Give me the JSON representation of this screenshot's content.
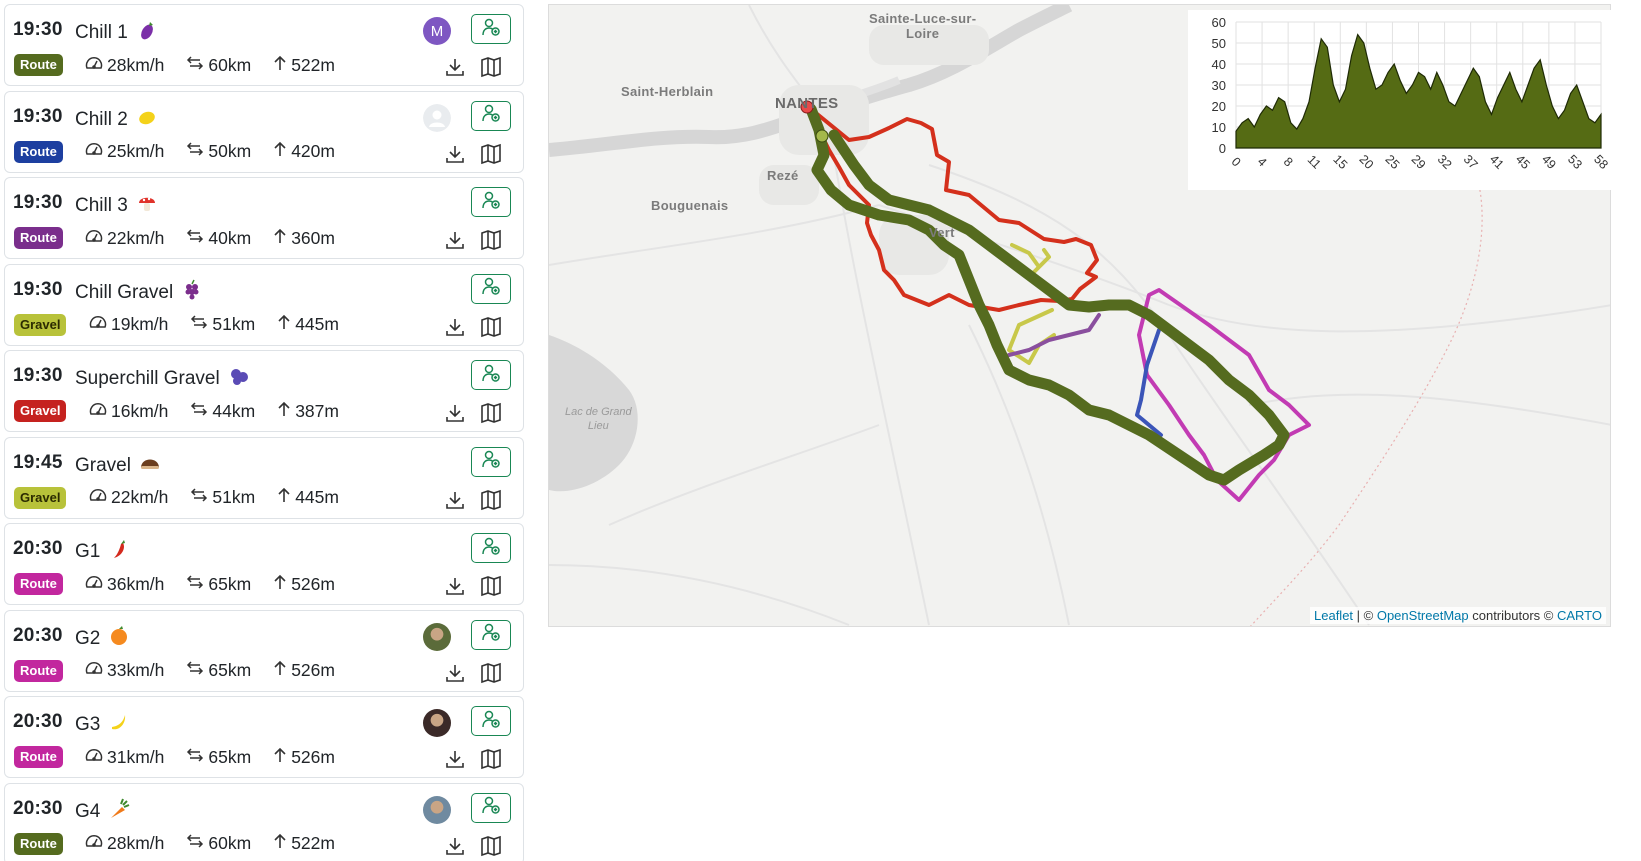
{
  "rides": [
    {
      "time": "19:30",
      "name": "Chill 1",
      "emoji": "eggplant",
      "avatar": {
        "type": "letter",
        "letter": "M",
        "color": "#7e57c2"
      },
      "badge": "Route",
      "badge_color": "#556b1f",
      "speed": "28km/h",
      "distance": "60km",
      "elevation": "522m"
    },
    {
      "time": "19:30",
      "name": "Chill 2",
      "emoji": "lemon",
      "avatar": {
        "type": "placeholder"
      },
      "badge": "Route",
      "badge_color": "#1d3fa0",
      "speed": "25km/h",
      "distance": "50km",
      "elevation": "420m"
    },
    {
      "time": "19:30",
      "name": "Chill 3",
      "emoji": "mushroom",
      "avatar": {
        "type": "none"
      },
      "badge": "Route",
      "badge_color": "#7a2e8c",
      "speed": "22km/h",
      "distance": "40km",
      "elevation": "360m"
    },
    {
      "time": "19:30",
      "name": "Chill Gravel",
      "emoji": "grapes",
      "avatar": {
        "type": "none"
      },
      "badge": "Gravel",
      "badge_color": "#b8c23a",
      "badge_text_color": "#2b2b00",
      "speed": "19km/h",
      "distance": "51km",
      "elevation": "445m"
    },
    {
      "time": "19:30",
      "name": "Superchill Gravel",
      "emoji": "blueberries",
      "avatar": {
        "type": "none"
      },
      "badge": "Gravel",
      "badge_color": "#c5221f",
      "speed": "16km/h",
      "distance": "44km",
      "elevation": "387m"
    },
    {
      "time": "19:45",
      "name": "Gravel",
      "emoji": "chestnut",
      "avatar": {
        "type": "none"
      },
      "badge": "Gravel",
      "badge_color": "#b8c23a",
      "badge_text_color": "#2b2b00",
      "speed": "22km/h",
      "distance": "51km",
      "elevation": "445m"
    },
    {
      "time": "20:30",
      "name": "G1",
      "emoji": "hot-pepper",
      "avatar": {
        "type": "none"
      },
      "badge": "Route",
      "badge_color": "#c2279e",
      "speed": "36km/h",
      "distance": "65km",
      "elevation": "526m"
    },
    {
      "time": "20:30",
      "name": "G2",
      "emoji": "tangerine",
      "avatar": {
        "type": "photo",
        "color": "#5b6b3a"
      },
      "badge": "Route",
      "badge_color": "#c2279e",
      "speed": "33km/h",
      "distance": "65km",
      "elevation": "526m"
    },
    {
      "time": "20:30",
      "name": "G3",
      "emoji": "banana",
      "avatar": {
        "type": "photo",
        "color": "#3b2a28"
      },
      "badge": "Route",
      "badge_color": "#c2279e",
      "speed": "31km/h",
      "distance": "65km",
      "elevation": "526m"
    },
    {
      "time": "20:30",
      "name": "G4",
      "emoji": "carrot",
      "avatar": {
        "type": "photo",
        "color": "#6f8aa0"
      },
      "badge": "Route",
      "badge_color": "#556b1f",
      "speed": "28km/h",
      "distance": "60km",
      "elevation": "522m"
    }
  ],
  "map": {
    "labels": {
      "sainte_luce": "Sainte-Luce-sur-\nLoire",
      "saint_herblain": "Saint-Herblain",
      "nantes": "NANTES",
      "reze": "Rezé",
      "bouguenais": "Bouguenais",
      "vertou": "Vert",
      "lake": "Lac de Grand\nLieu"
    },
    "attribution": {
      "leaflet": "Leaflet",
      "sep1": " | © ",
      "osm": "OpenStreetMap",
      "mid": " contributors © ",
      "carto": "CARTO"
    },
    "route_colors": {
      "selected": "#556b1f",
      "red": "#d4301c",
      "magenta": "#c23bb3",
      "blue": "#3b55b8",
      "yellow": "#c8c84a",
      "purple": "#8a4f9e",
      "start": "#e84a4a"
    }
  },
  "elevation_chart": {
    "type": "area",
    "fill_color": "#556b14",
    "y_ticks": [
      "60",
      "50",
      "40",
      "30",
      "20",
      "10",
      "0"
    ],
    "x_ticks": [
      "0",
      "4",
      "8",
      "11",
      "15",
      "20",
      "25",
      "29",
      "32",
      "37",
      "41",
      "45",
      "49",
      "53",
      "58"
    ],
    "ylim": [
      0,
      60
    ],
    "x": [
      0,
      1,
      2,
      3,
      4,
      5,
      6,
      7,
      8,
      9,
      10,
      11,
      12,
      13,
      14,
      15,
      16,
      17,
      18,
      19,
      20,
      21,
      22,
      23,
      24,
      25,
      26,
      27,
      28,
      29,
      30,
      31,
      32,
      33,
      34,
      35,
      36,
      37,
      38,
      39,
      40,
      41,
      42,
      43,
      44,
      45,
      46,
      47,
      48,
      49,
      50,
      51,
      52,
      53,
      54,
      55,
      56,
      57,
      58,
      59,
      60
    ],
    "values": [
      8,
      12,
      14,
      10,
      16,
      20,
      18,
      24,
      22,
      12,
      9,
      14,
      22,
      38,
      52,
      48,
      30,
      22,
      28,
      44,
      54,
      50,
      38,
      28,
      30,
      36,
      40,
      32,
      26,
      30,
      36,
      34,
      28,
      36,
      30,
      22,
      20,
      26,
      32,
      38,
      34,
      22,
      16,
      24,
      30,
      36,
      28,
      22,
      30,
      38,
      42,
      30,
      20,
      14,
      18,
      26,
      30,
      22,
      14,
      12,
      16
    ]
  }
}
